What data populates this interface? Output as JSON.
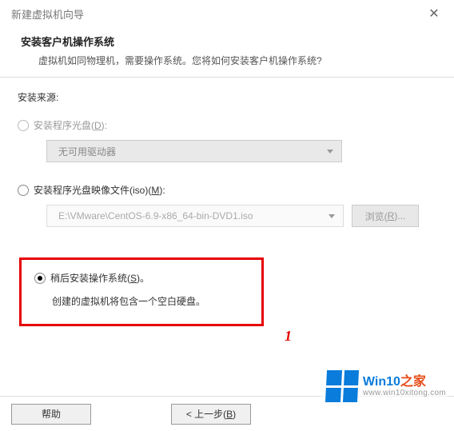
{
  "titlebar": {
    "title": "新建虚拟机向导"
  },
  "header": {
    "heading": "安装客户机操作系统",
    "subheading": "虚拟机如同物理机，需要操作系统。您将如何安装客户机操作系统?"
  },
  "source": {
    "label": "安装来源:"
  },
  "option_disc": {
    "label_pre": "安装程序光盘(",
    "mnemonic": "D",
    "label_post": "):",
    "dropdown_value": "无可用驱动器"
  },
  "option_iso": {
    "label_pre": "安装程序光盘映像文件(iso)(",
    "mnemonic": "M",
    "label_post": "):",
    "dropdown_value": "E:\\VMware\\CentOS-6.9-x86_64-bin-DVD1.iso",
    "browse_pre": "浏览(",
    "browse_mn": "R",
    "browse_post": ")..."
  },
  "option_later": {
    "label_pre": "稍后安装操作系统(",
    "mnemonic": "S",
    "label_post": ")。",
    "desc": "创建的虚拟机将包含一个空白硬盘。"
  },
  "annotation": {
    "one": "1"
  },
  "buttons": {
    "help": "帮助",
    "back_pre": "< 上一步(",
    "back_mn": "B",
    "back_post": ")"
  },
  "watermark": {
    "brand_a": "Win10",
    "brand_b": "之家",
    "url": "www.win10xitong.com"
  }
}
